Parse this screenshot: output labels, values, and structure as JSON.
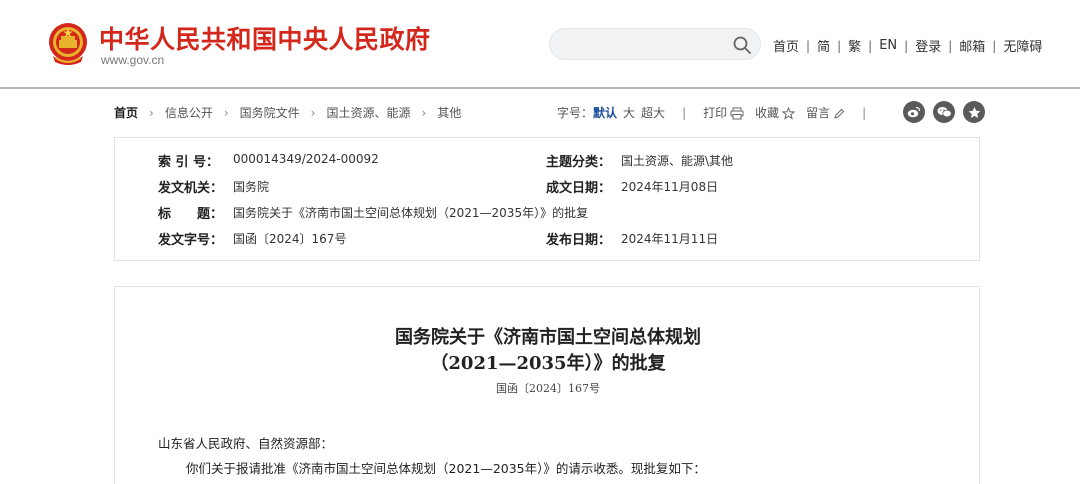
{
  "header": {
    "site_title": "中华人民共和国中央人民政府",
    "site_url": "www.gov.cn",
    "search": {
      "value": "",
      "placeholder": ""
    },
    "nav": [
      "首页",
      "简",
      "繁",
      "EN",
      "登录",
      "邮箱",
      "无障碍"
    ],
    "brand_color": "#d4271c"
  },
  "breadcrumb": [
    "首页",
    "信息公开",
    "国务院文件",
    "国土资源、能源",
    "其他"
  ],
  "tools": {
    "font_size_label": "字号：",
    "font_size_options": [
      "默认",
      "大",
      "超大"
    ],
    "active_size": "默认",
    "print": "打印",
    "favorite": "收藏",
    "comment": "留言",
    "share_icons": [
      "weibo-icon",
      "wechat-icon",
      "qzone-icon"
    ]
  },
  "meta": {
    "index_no": {
      "label": "索 引 号：",
      "value": "000014349/2024-00092"
    },
    "category": {
      "label": "主题分类：",
      "value": "国土资源、能源\\其他"
    },
    "issuer": {
      "label": "发文机关：",
      "value": "国务院"
    },
    "written_date": {
      "label": "成文日期：",
      "value": "2024年11月08日"
    },
    "title": {
      "label": "标　　题：",
      "value": "国务院关于《济南市国土空间总体规划（2021—2035年）》的批复"
    },
    "doc_no": {
      "label": "发文字号：",
      "value": "国函〔2024〕167号"
    },
    "publish_date": {
      "label": "发布日期：",
      "value": "2024年11月11日"
    }
  },
  "article": {
    "title_line1": "国务院关于《济南市国土空间总体规划",
    "title_line2": "（2021—2035年）》的批复",
    "doc_no": "国函〔2024〕167号",
    "salutation": "山东省人民政府、自然资源部：",
    "para1": "你们关于报请批准《济南市国土空间总体规划（2021—2035年）》的请示收悉。现批复如下："
  }
}
